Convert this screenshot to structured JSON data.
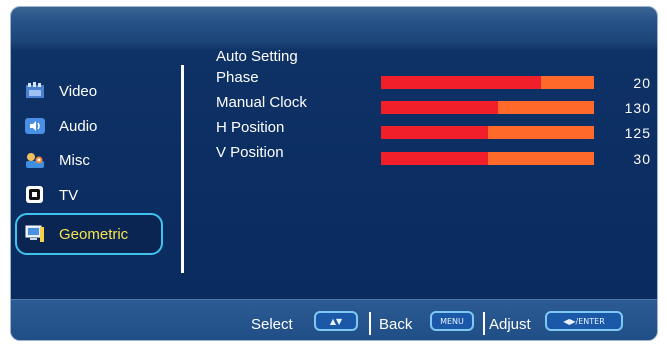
{
  "sidebar": {
    "items": [
      {
        "label": "Video",
        "icon": "video-icon"
      },
      {
        "label": "Audio",
        "icon": "audio-icon"
      },
      {
        "label": "Misc",
        "icon": "misc-icon"
      },
      {
        "label": "TV",
        "icon": "tv-icon"
      },
      {
        "label": "Geometric",
        "icon": "geometric-icon",
        "selected": true
      }
    ]
  },
  "main": {
    "auto_setting_label": "Auto Setting",
    "params": [
      {
        "label": "Phase",
        "value": "20",
        "level": 0.75
      },
      {
        "label": "Manual Clock",
        "value": "130",
        "level": 0.55
      },
      {
        "label": "H Position",
        "value": "125",
        "level": 0.5
      },
      {
        "label": "V Position",
        "value": "30",
        "level": 0.5
      }
    ]
  },
  "footer": {
    "select_label": "Select",
    "select_key": "▲▼",
    "back_label": "Back",
    "back_key": "MENU",
    "adjust_label": "Adjust",
    "adjust_key": "◀▶/ENTER"
  },
  "colors": {
    "bar_fill": "#f01f2a",
    "bar_track": "#ff6a2a",
    "selected_text": "#f7e34a",
    "selected_border": "#3fc3ee"
  }
}
